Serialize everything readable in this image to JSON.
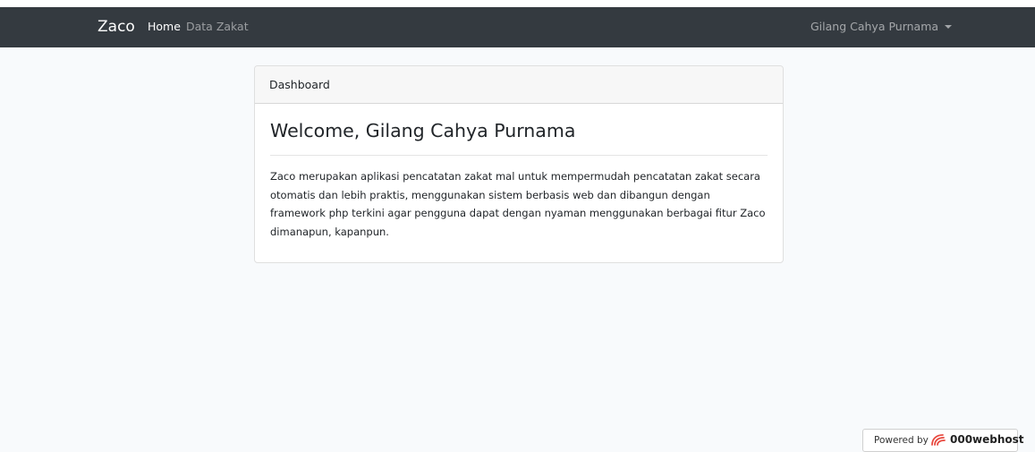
{
  "navbar": {
    "brand": "Zaco",
    "links": [
      {
        "label": "Home"
      },
      {
        "label": "Data Zakat"
      }
    ],
    "user": "Gilang Cahya Purnama"
  },
  "card": {
    "header": "Dashboard",
    "title": "Welcome, Gilang Cahya Purnama",
    "description": "Zaco merupakan aplikasi pencatatan zakat mal untuk mempermudah pencatatan zakat secara otomatis dan lebih praktis, menggunakan sistem berbasis web dan dibangun dengan framework php terkini agar pengguna dapat dengan nyaman menggunakan berbagai fitur Zaco dimanapun, kapanpun."
  },
  "badge": {
    "prefix": "Powered by",
    "brand": "000webhost"
  },
  "colors": {
    "navbar": "#343a40",
    "background": "#f8fafc",
    "webhost_logo": "#e8493f"
  },
  "icons": {
    "user_dropdown": "caret-down-icon",
    "badge_logo": "000webhost-logo-icon"
  }
}
